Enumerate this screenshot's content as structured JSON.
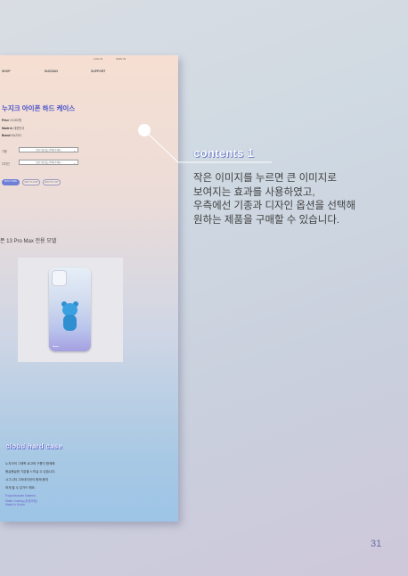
{
  "screenshot": {
    "topbar": [
      "LOG IN",
      "SIGN IN"
    ],
    "nav": [
      "SHOP",
      "NUZZIAN",
      "SUPPORT"
    ],
    "product_title": "누지크 아이폰 하드 케이스",
    "info": [
      {
        "label": "Price",
        "value": "10,000원"
      },
      {
        "label": "Made in",
        "value": "대한민국"
      },
      {
        "label": "Brand",
        "value": "NUZZIC"
      }
    ],
    "options": [
      {
        "label": "기종",
        "placeholder": "- [필수] 옵션을 선택해 주세요 -"
      },
      {
        "label": "디자인",
        "placeholder": "- [필수] 옵션을 선택해 주세요 -"
      }
    ],
    "buttons": [
      "BUY IT NOW",
      "ADD TO CART",
      "WISH TO LIST"
    ],
    "model_heading": "폰 13 Pro Max 전용 모델",
    "phone_brand": "Nuzzic",
    "cloud_title": "cloud hard case",
    "cloud_desc": [
      "누지크의 그레픽 로고와 구름이 함께해",
      "몽글몽글한 기분을 느끼실 수 있습니다.",
      "시그니처 그라데이션이 함께 몽여",
      "하게 쓸 수 있가드 해요."
    ],
    "cloud_spec": [
      "Polycarbonate Material",
      "Matte Coating (무광코팅)",
      "Made In Korea"
    ]
  },
  "contents": {
    "title": "contents 1",
    "lines": [
      "작은 이미지를 누르면 큰 이미지로",
      "보여지는 효과를 사용하였고,",
      "우측에선 기종과 디자인 옵션을 선택해",
      "원하는 제품을 구매할 수 있습니다."
    ]
  },
  "page_number": "31",
  "colors": {
    "accent_blue": "#4650c8",
    "button_blue": "#6e7fd6",
    "page_number": "#6b6fa8"
  }
}
